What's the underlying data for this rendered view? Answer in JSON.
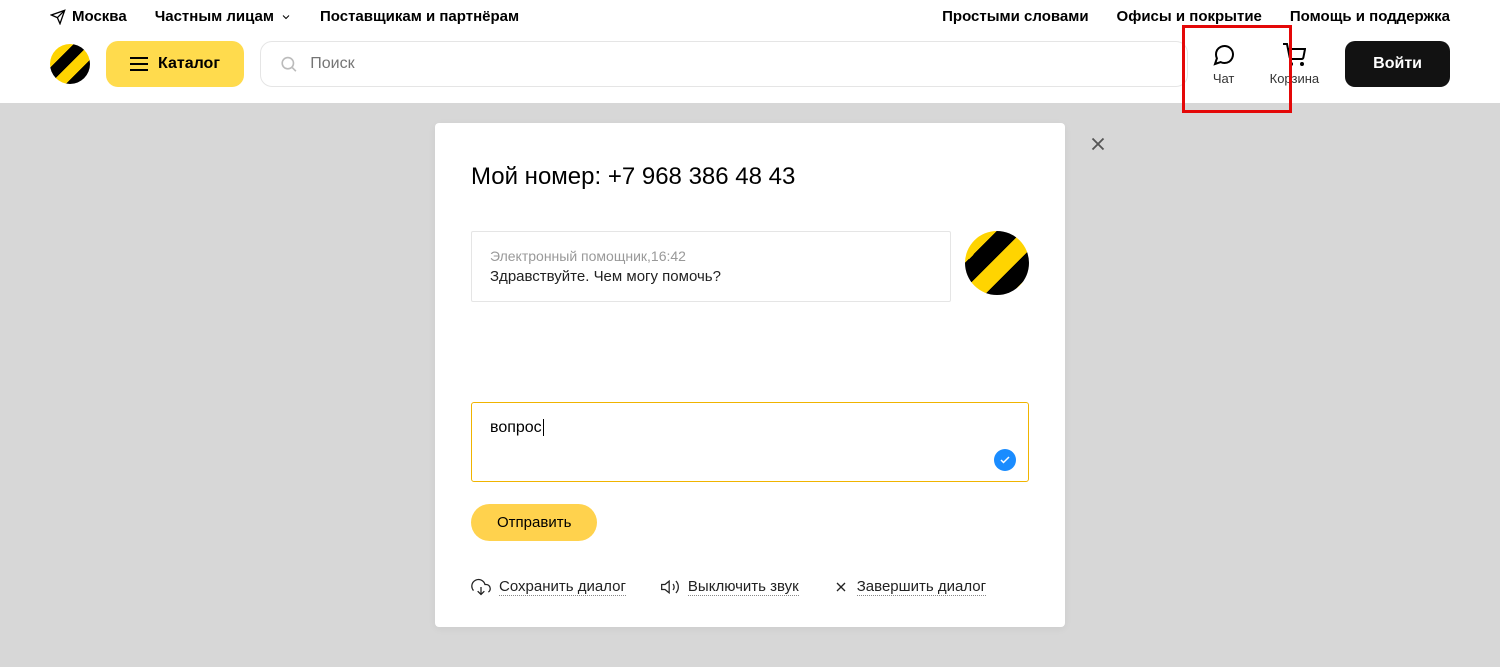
{
  "topbar": {
    "location": "Москва",
    "nav1": "Частным лицам",
    "nav2": "Поставщикам и партнёрам",
    "right1": "Простыми словами",
    "right2": "Офисы и покрытие",
    "right3": "Помощь и поддержка"
  },
  "mainbar": {
    "catalog": "Каталог",
    "search_placeholder": "Поиск",
    "chat_label": "Чат",
    "cart_label": "Корзина",
    "login": "Войти"
  },
  "chat": {
    "title_prefix": "Мой номер: ",
    "phone": "+7 968 386 48 43",
    "msg_sender": "Электронный помощник,",
    "msg_time": "16:42",
    "msg_text": "Здравствуйте. Чем могу помочь?",
    "input_value": "вопрос",
    "send": "Отправить",
    "action_save": "Сохранить диалог",
    "action_mute": "Выключить звук",
    "action_end": "Завершить диалог"
  }
}
